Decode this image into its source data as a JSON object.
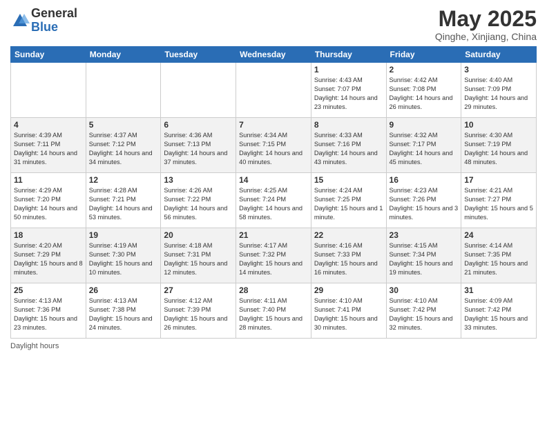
{
  "logo": {
    "general": "General",
    "blue": "Blue"
  },
  "header": {
    "month": "May 2025",
    "location": "Qinghe, Xinjiang, China"
  },
  "days_of_week": [
    "Sunday",
    "Monday",
    "Tuesday",
    "Wednesday",
    "Thursday",
    "Friday",
    "Saturday"
  ],
  "footer": {
    "daylight_label": "Daylight hours"
  },
  "weeks": [
    [
      {
        "day": "",
        "info": ""
      },
      {
        "day": "",
        "info": ""
      },
      {
        "day": "",
        "info": ""
      },
      {
        "day": "",
        "info": ""
      },
      {
        "day": "1",
        "info": "Sunrise: 4:43 AM\nSunset: 7:07 PM\nDaylight: 14 hours\nand 23 minutes."
      },
      {
        "day": "2",
        "info": "Sunrise: 4:42 AM\nSunset: 7:08 PM\nDaylight: 14 hours\nand 26 minutes."
      },
      {
        "day": "3",
        "info": "Sunrise: 4:40 AM\nSunset: 7:09 PM\nDaylight: 14 hours\nand 29 minutes."
      }
    ],
    [
      {
        "day": "4",
        "info": "Sunrise: 4:39 AM\nSunset: 7:11 PM\nDaylight: 14 hours\nand 31 minutes."
      },
      {
        "day": "5",
        "info": "Sunrise: 4:37 AM\nSunset: 7:12 PM\nDaylight: 14 hours\nand 34 minutes."
      },
      {
        "day": "6",
        "info": "Sunrise: 4:36 AM\nSunset: 7:13 PM\nDaylight: 14 hours\nand 37 minutes."
      },
      {
        "day": "7",
        "info": "Sunrise: 4:34 AM\nSunset: 7:15 PM\nDaylight: 14 hours\nand 40 minutes."
      },
      {
        "day": "8",
        "info": "Sunrise: 4:33 AM\nSunset: 7:16 PM\nDaylight: 14 hours\nand 43 minutes."
      },
      {
        "day": "9",
        "info": "Sunrise: 4:32 AM\nSunset: 7:17 PM\nDaylight: 14 hours\nand 45 minutes."
      },
      {
        "day": "10",
        "info": "Sunrise: 4:30 AM\nSunset: 7:19 PM\nDaylight: 14 hours\nand 48 minutes."
      }
    ],
    [
      {
        "day": "11",
        "info": "Sunrise: 4:29 AM\nSunset: 7:20 PM\nDaylight: 14 hours\nand 50 minutes."
      },
      {
        "day": "12",
        "info": "Sunrise: 4:28 AM\nSunset: 7:21 PM\nDaylight: 14 hours\nand 53 minutes."
      },
      {
        "day": "13",
        "info": "Sunrise: 4:26 AM\nSunset: 7:22 PM\nDaylight: 14 hours\nand 56 minutes."
      },
      {
        "day": "14",
        "info": "Sunrise: 4:25 AM\nSunset: 7:24 PM\nDaylight: 14 hours\nand 58 minutes."
      },
      {
        "day": "15",
        "info": "Sunrise: 4:24 AM\nSunset: 7:25 PM\nDaylight: 15 hours\nand 1 minute."
      },
      {
        "day": "16",
        "info": "Sunrise: 4:23 AM\nSunset: 7:26 PM\nDaylight: 15 hours\nand 3 minutes."
      },
      {
        "day": "17",
        "info": "Sunrise: 4:21 AM\nSunset: 7:27 PM\nDaylight: 15 hours\nand 5 minutes."
      }
    ],
    [
      {
        "day": "18",
        "info": "Sunrise: 4:20 AM\nSunset: 7:29 PM\nDaylight: 15 hours\nand 8 minutes."
      },
      {
        "day": "19",
        "info": "Sunrise: 4:19 AM\nSunset: 7:30 PM\nDaylight: 15 hours\nand 10 minutes."
      },
      {
        "day": "20",
        "info": "Sunrise: 4:18 AM\nSunset: 7:31 PM\nDaylight: 15 hours\nand 12 minutes."
      },
      {
        "day": "21",
        "info": "Sunrise: 4:17 AM\nSunset: 7:32 PM\nDaylight: 15 hours\nand 14 minutes."
      },
      {
        "day": "22",
        "info": "Sunrise: 4:16 AM\nSunset: 7:33 PM\nDaylight: 15 hours\nand 16 minutes."
      },
      {
        "day": "23",
        "info": "Sunrise: 4:15 AM\nSunset: 7:34 PM\nDaylight: 15 hours\nand 19 minutes."
      },
      {
        "day": "24",
        "info": "Sunrise: 4:14 AM\nSunset: 7:35 PM\nDaylight: 15 hours\nand 21 minutes."
      }
    ],
    [
      {
        "day": "25",
        "info": "Sunrise: 4:13 AM\nSunset: 7:36 PM\nDaylight: 15 hours\nand 23 minutes."
      },
      {
        "day": "26",
        "info": "Sunrise: 4:13 AM\nSunset: 7:38 PM\nDaylight: 15 hours\nand 24 minutes."
      },
      {
        "day": "27",
        "info": "Sunrise: 4:12 AM\nSunset: 7:39 PM\nDaylight: 15 hours\nand 26 minutes."
      },
      {
        "day": "28",
        "info": "Sunrise: 4:11 AM\nSunset: 7:40 PM\nDaylight: 15 hours\nand 28 minutes."
      },
      {
        "day": "29",
        "info": "Sunrise: 4:10 AM\nSunset: 7:41 PM\nDaylight: 15 hours\nand 30 minutes."
      },
      {
        "day": "30",
        "info": "Sunrise: 4:10 AM\nSunset: 7:42 PM\nDaylight: 15 hours\nand 32 minutes."
      },
      {
        "day": "31",
        "info": "Sunrise: 4:09 AM\nSunset: 7:42 PM\nDaylight: 15 hours\nand 33 minutes."
      }
    ]
  ]
}
